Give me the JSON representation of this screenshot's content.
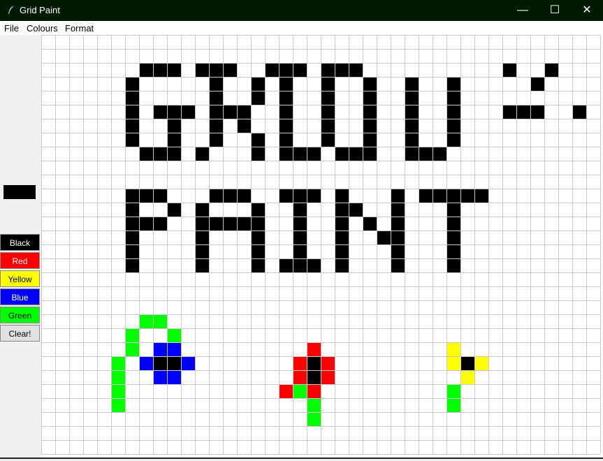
{
  "window": {
    "title": "Grid Paint"
  },
  "menu": [
    "File",
    "Colours",
    "Format"
  ],
  "palette": {
    "current_colour": "#000000",
    "buttons": [
      {
        "label": "Black",
        "bg": "#000000",
        "fg": "#ffffff"
      },
      {
        "label": "Red",
        "bg": "#ff0000",
        "fg": "#ffffff"
      },
      {
        "label": "Yellow",
        "bg": "#ffff00",
        "fg": "#000000"
      },
      {
        "label": "Blue",
        "bg": "#0000ff",
        "fg": "#ffffff"
      },
      {
        "label": "Green",
        "bg": "#00ff00",
        "fg": "#000000"
      }
    ],
    "clear_label": "Clear!"
  },
  "grid": {
    "columns": 40,
    "rows": 30,
    "line_colour": "#c8c8c8",
    "background": "#ffffff",
    "colours": {
      "K": "#000000",
      "R": "#ff0000",
      "Y": "#ffff00",
      "B": "#0000ff",
      "G": "#00ff00"
    },
    "pixels": [
      "........................................",
      "........................................",
      ".......KKK.KKK..KKK.KKK..........K..K...",
      "......K.....K..K.K..K..K..K..K.....K....",
      "......K.....K..K.K..K..K..K..K.........",
      "......K.KKK.KKK..K..K..K..K..K...KKK..K.",
      "......K..K..K.K..K..K..K..K..K..........",
      "......K..K..K..K.K..K..K..K..K..........",
      ".......KKK.K...K.KKK.KKK..KKK...........",
      "........................................",
      "........................................",
      "......KKK...KKK..KKK.K...K.KKKKK........",
      "......K..K.K...K..K..KK..K...K..........",
      "......KKK..KKKKK..K..K.K.K...K..........",
      "......K....K...K..K..K..KK...K..........",
      "......K....K...K..K..K...K...K..........",
      "......K....K...K.KKK.K...K...K..........",
      "........................................",
      "........................................",
      "........................................",
      ".......GG...............................",
      "......G..G..............................",
      "......G.BB.........R.........Y..........",
      ".....G.BKKB.......RKR........YKY.........",
      ".....G..BB........RKR.........Y..........",
      ".....G...........RGR.........G..........",
      ".....G.............G.........G..........",
      "...................G....................",
      "........................................",
      "........................................"
    ]
  }
}
